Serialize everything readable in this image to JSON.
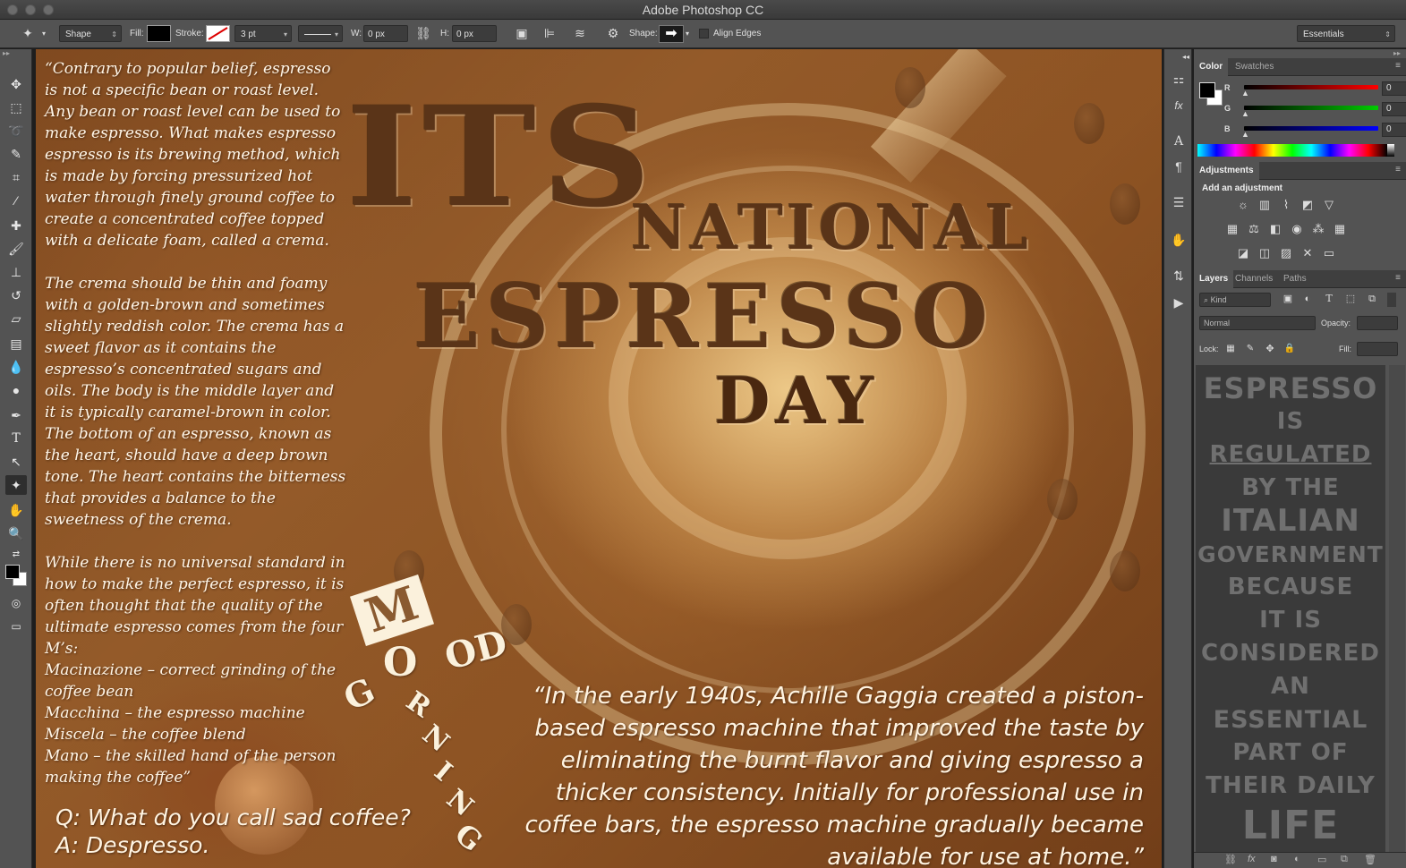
{
  "app": {
    "title": "Adobe Photoshop CC"
  },
  "options_bar": {
    "tool_mode": "Shape",
    "fill_label": "Fill:",
    "stroke_label": "Stroke:",
    "stroke_width": "3 pt",
    "w_label": "W:",
    "w_value": "0 px",
    "h_label": "H:",
    "h_value": "0 px",
    "shape_label": "Shape:",
    "align_edges_label": "Align Edges",
    "workspace": "Essentials"
  },
  "canvas": {
    "intro_paragraphs": [
      "“Contrary to popular belief, espresso is not a specific bean or roast level. Any bean or roast level can be used to make espresso. What makes espresso espresso is its brewing method, which is made by forcing pressurized hot water through finely ground coffee to create a concentrated coffee topped with a delicate foam, called a crema.",
      "The crema should be thin and foamy with a golden-brown and sometimes slightly reddish color. The crema has a sweet flavor as it contains the espresso’s concentrated sugars and oils. The body is the middle layer and it is typically caramel-brown in color. The bottom of an espresso, known as the heart, should have a deep brown tone. The heart contains the bitterness that provides a balance to the sweetness of the crema.",
      "While there is no universal standard in how to make the perfect espresso, it is often thought that the quality of the ultimate espresso comes from the four M’s:"
    ],
    "four_ms": [
      "Macinazione – correct grinding of the coffee bean",
      " Macchina – the espresso machine",
      "Miscela – the coffee blend",
      "Mano – the skilled hand of the person making the coffee”"
    ],
    "title_its": "ITS",
    "title_national": "NATIONAL",
    "title_espresso": "ESPRESSO",
    "title_day": "DAY",
    "good_morning": {
      "m": "M",
      "good": [
        "G",
        "O",
        "OD"
      ],
      "rning": [
        "R",
        "N",
        "I",
        "N",
        "G"
      ]
    },
    "quote": "“In the early 1940s, Achille Gaggia created a piston-based espresso machine that improved the taste by eliminating the burnt flavor and giving espresso a thicker consistency. Initially for professional use in coffee bars, the espresso machine gradually became available for use at home.”",
    "joke_q": "Q: What do you call sad coffee?",
    "joke_a": "A: Despresso."
  },
  "panels": {
    "color": {
      "tabs": [
        "Color",
        "Swatches"
      ],
      "r_label": "R",
      "r_value": "0",
      "g_label": "G",
      "g_value": "0",
      "b_label": "B",
      "b_value": "0"
    },
    "adjustments": {
      "tab": "Adjustments",
      "heading": "Add an adjustment"
    },
    "layers": {
      "tabs": [
        "Layers",
        "Channels",
        "Paths"
      ],
      "kind_label": "Kind",
      "blend_mode": "Normal",
      "opacity_label": "Opacity:",
      "lock_label": "Lock:",
      "fill_label": "Fill:",
      "layer_text_lines": [
        "ESPRESSO",
        "IS",
        "REGULATED",
        "BY THE",
        "ITALIAN",
        "GOVERNMENT",
        "BECAUSE",
        "IT IS",
        "CONSIDERED",
        "AN",
        "ESSENTIAL",
        "PART OF",
        "THEIR DAILY",
        "LIFE"
      ]
    }
  },
  "colors": {
    "ui_dark": "#535353",
    "ui_darker": "#3c3c3c",
    "headline_brown": "#5a3418",
    "text_cream": "#fff6e8"
  }
}
